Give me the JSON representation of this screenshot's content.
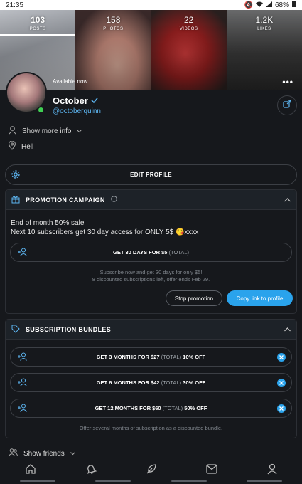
{
  "status_bar": {
    "time": "21:35",
    "battery": "68%"
  },
  "stats": [
    {
      "value": "103",
      "label": "POSTS",
      "active": true
    },
    {
      "value": "158",
      "label": "PHOTOS",
      "active": false
    },
    {
      "value": "22",
      "label": "VIDEOS",
      "active": false
    },
    {
      "value": "1.2K",
      "label": "LIKES",
      "active": false
    }
  ],
  "banner": {
    "availability": "Available now",
    "more": "•••"
  },
  "profile": {
    "name": "October",
    "handle": "@octoberquinn",
    "verified": true,
    "online": true
  },
  "info": {
    "show_more": "Show more info",
    "location": "Hell"
  },
  "edit_profile": {
    "label": "EDIT PROFILE"
  },
  "promotion": {
    "title": "PROMOTION CAMPAIGN",
    "line1": "End of month 50% sale",
    "line2": "Next 10 subscribers get 30 day access for ONLY 5$ 😘xxxx",
    "offer_main": "GET 30 DAYS FOR $5",
    "offer_total": "(TOTAL)",
    "note_line1": "Subscribe now and get 30 days for only $5!",
    "note_line2": "8 discounted subscriptions left, offer ends Feb 29.",
    "stop_label": "Stop promotion",
    "copy_label": "Copy link to profile"
  },
  "bundles": {
    "title": "SUBSCRIPTION BUNDLES",
    "items": [
      {
        "main": "GET 3 MONTHS FOR $27",
        "total": "(TOTAL)",
        "discount": "10% OFF"
      },
      {
        "main": "GET 6 MONTHS FOR $42",
        "total": "(TOTAL)",
        "discount": "30% OFF"
      },
      {
        "main": "GET 12 MONTHS FOR $60",
        "total": "(TOTAL)",
        "discount": "50% OFF"
      }
    ],
    "note": "Offer several months of subscription as a discounted bundle."
  },
  "friends": {
    "label": "Show friends"
  },
  "colors": {
    "accent": "#2aa3ec",
    "online": "#3fcf53",
    "background": "#16181c"
  },
  "bottom_nav": [
    "home-icon",
    "bell-icon",
    "feather-icon",
    "message-icon",
    "profile-icon"
  ]
}
